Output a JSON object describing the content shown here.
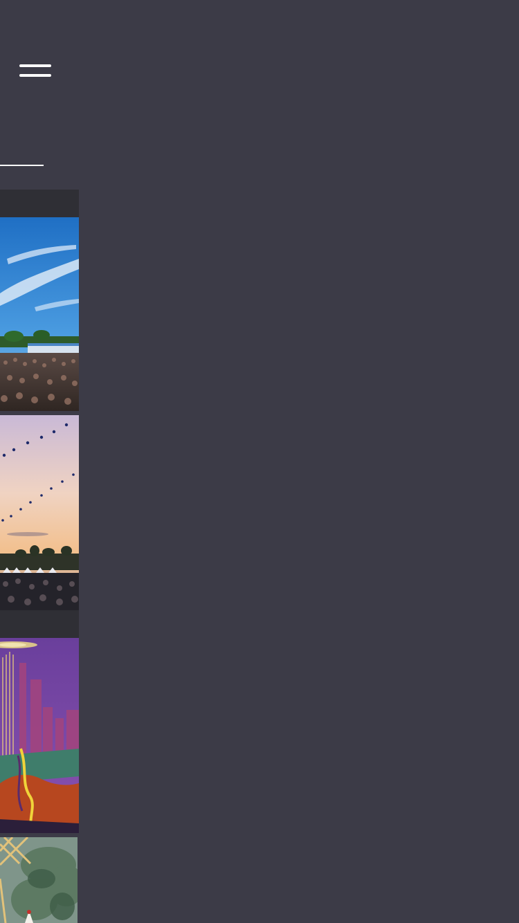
{
  "header": {
    "menu_icon": "hamburger-menu-icon"
  },
  "gallery": {
    "items": [
      {
        "name": "festival-photo-daytime-crowd",
        "icon": "photo-thumbnail"
      },
      {
        "name": "festival-photo-sunset-crowd",
        "icon": "photo-thumbnail"
      },
      {
        "name": "festival-poster-illustration",
        "icon": "artwork-thumbnail"
      },
      {
        "name": "festival-photo-forest-structure",
        "icon": "photo-thumbnail"
      }
    ]
  },
  "colors": {
    "background": "#3c3b47",
    "header_bar": "#2f2f35",
    "accent": "#ffffff"
  }
}
